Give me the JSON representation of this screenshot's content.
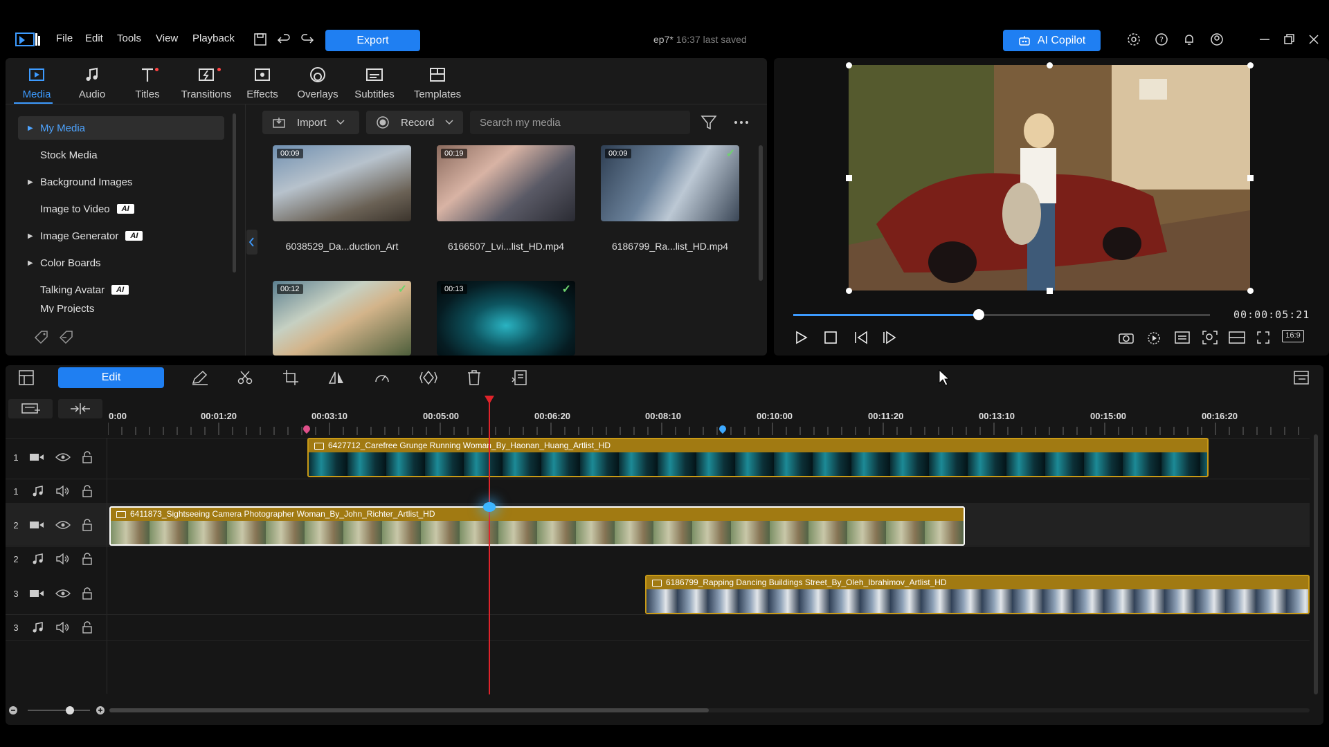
{
  "menu": [
    "File",
    "Edit",
    "Tools",
    "View",
    "Playback"
  ],
  "export_label": "Export",
  "project": {
    "name": "ep7*",
    "saved": "16:37 last saved"
  },
  "copilot_label": "AI Copilot",
  "tabs": [
    {
      "label": "Media",
      "icon": "media-icon"
    },
    {
      "label": "Audio",
      "icon": "music-note-icon"
    },
    {
      "label": "Titles",
      "icon": "title-t-icon"
    },
    {
      "label": "Transitions",
      "icon": "transition-icon"
    },
    {
      "label": "Effects",
      "icon": "effects-icon"
    },
    {
      "label": "Overlays",
      "icon": "overlays-icon"
    },
    {
      "label": "Subtitles",
      "icon": "subtitles-icon"
    },
    {
      "label": "Templates",
      "icon": "templates-icon"
    }
  ],
  "tree": [
    {
      "label": "My Media",
      "expandable": true,
      "selected": true
    },
    {
      "label": "Stock Media"
    },
    {
      "label": "Background Images",
      "expandable": true
    },
    {
      "label": "Image to Video",
      "ai": "AI"
    },
    {
      "label": "Image Generator",
      "expandable": true,
      "ai": "AI"
    },
    {
      "label": "Color Boards",
      "expandable": true
    },
    {
      "label": "Talking Avatar",
      "ai": "AI"
    },
    {
      "label": "My Projects"
    }
  ],
  "media_toolbar": {
    "import": "Import",
    "record": "Record",
    "search_placeholder": "Search my media"
  },
  "media": [
    {
      "duration": "00:09",
      "name": "6038529_Da...duction_Art",
      "checked": false
    },
    {
      "duration": "00:19",
      "name": "6166507_Lvi...list_HD.mp4",
      "checked": false
    },
    {
      "duration": "00:09",
      "name": "6186799_Ra...list_HD.mp4",
      "checked": true
    },
    {
      "duration": "00:12",
      "name": "",
      "checked": true
    },
    {
      "duration": "00:13",
      "name": "",
      "checked": true
    }
  ],
  "preview": {
    "timecode": "00:00:05:21",
    "aspect": "16:9",
    "progress": 0.445
  },
  "timeline": {
    "edit_label": "Edit",
    "ruler": [
      "0:00",
      "00:01:20",
      "00:03:10",
      "00:05:00",
      "00:06:20",
      "00:08:10",
      "00:10:00",
      "00:11:20",
      "00:13:10",
      "00:15:00",
      "00:16:20"
    ],
    "tracks": [
      {
        "num": "1",
        "type": "video"
      },
      {
        "num": "1",
        "type": "audio"
      },
      {
        "num": "2",
        "type": "video"
      },
      {
        "num": "2",
        "type": "audio"
      },
      {
        "num": "3",
        "type": "video"
      },
      {
        "num": "3",
        "type": "audio"
      }
    ],
    "clips": [
      {
        "track": "1",
        "name": "6427712_Carefree Grunge Running Woman_By_Haonan_Huang_Artlist_HD"
      },
      {
        "track": "2",
        "name": "6411873_Sightseeing Camera Photographer Woman_By_John_Richter_Artlist_HD"
      },
      {
        "track": "3",
        "name": "6186799_Rapping Dancing Buildings Street_By_Oleh_Ibrahimov_Artlist_HD"
      }
    ]
  },
  "colors": {
    "accent": "#1f7ff2",
    "clip": "#a17a12",
    "playhead": "#e0232a"
  }
}
